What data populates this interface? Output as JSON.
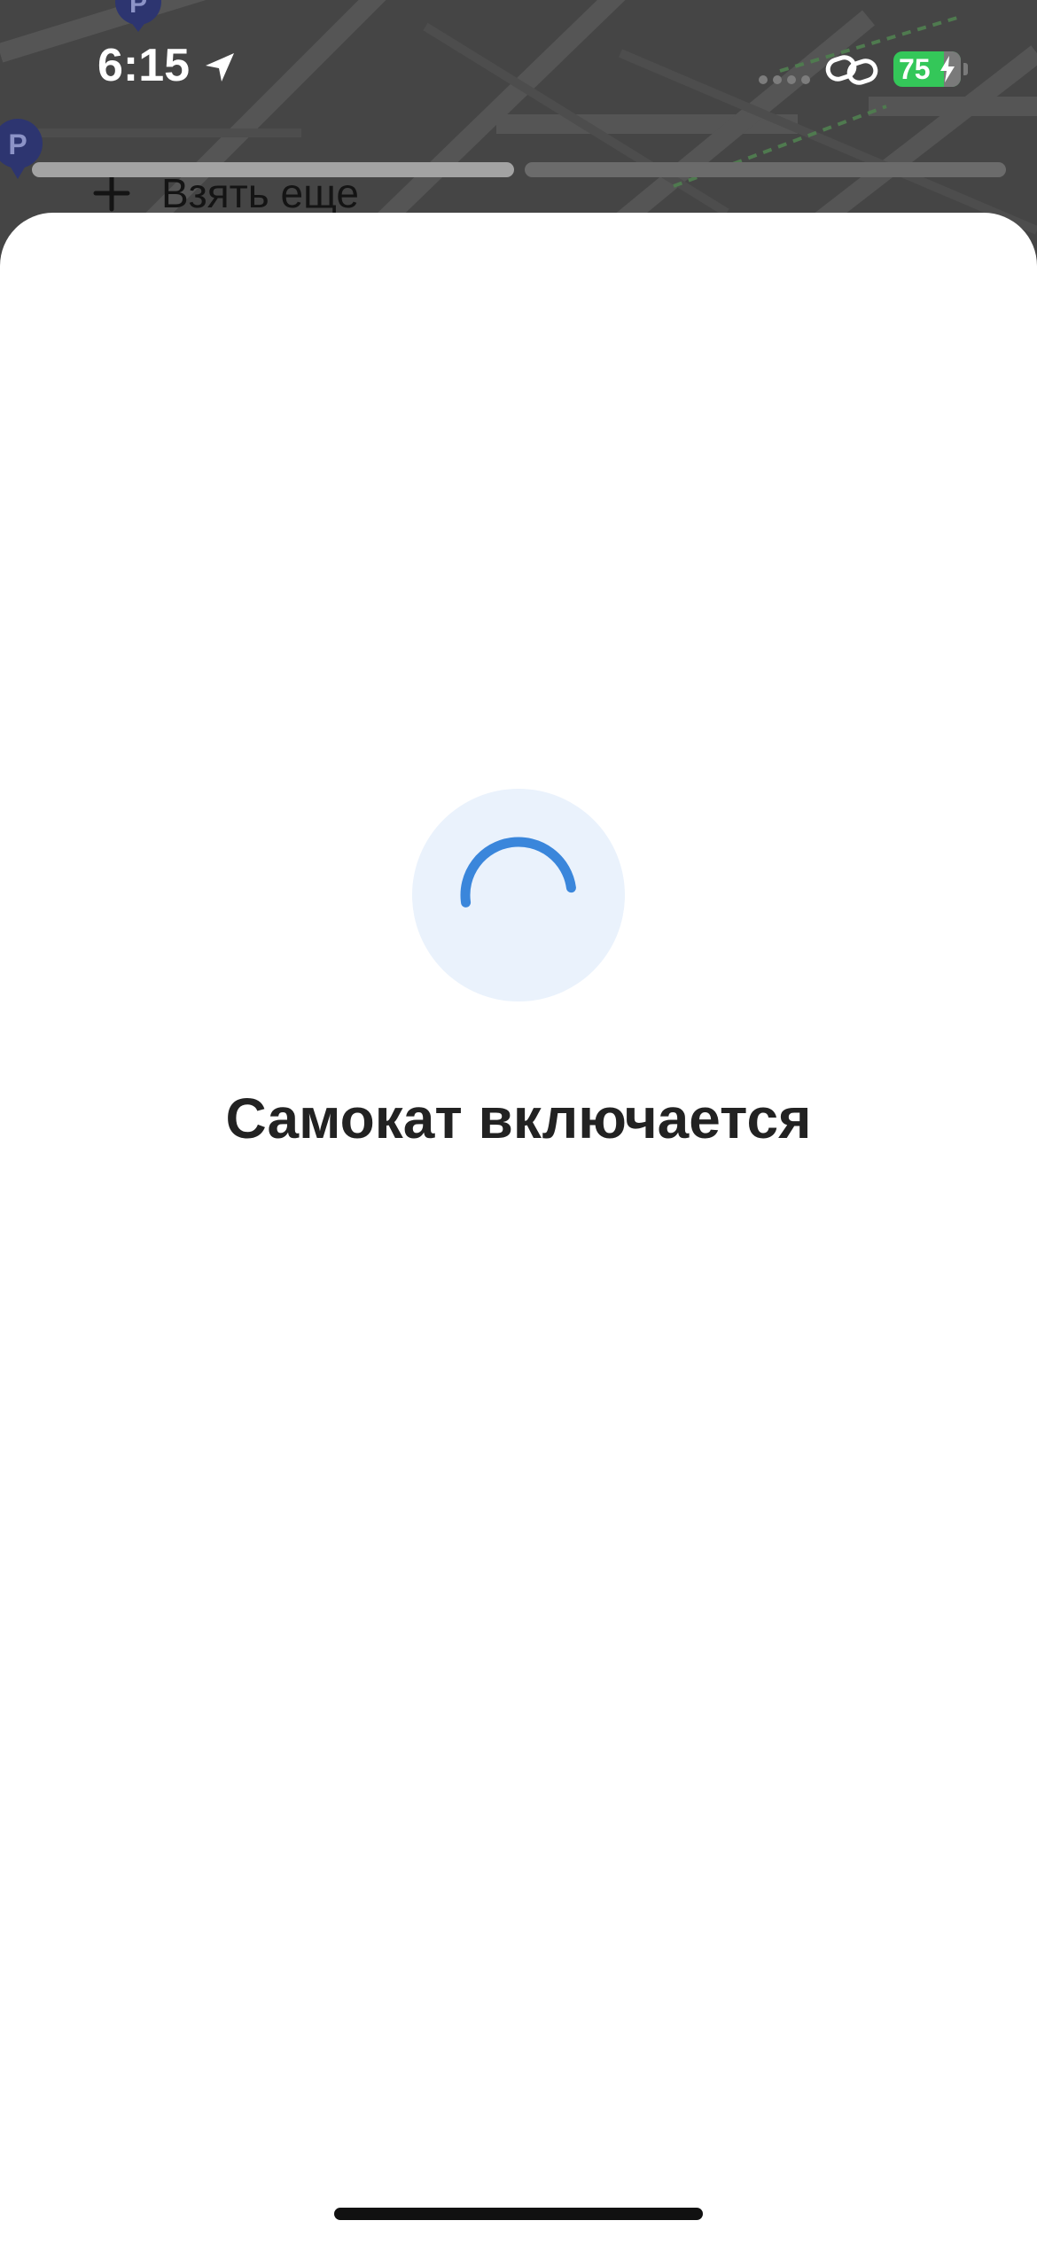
{
  "status_bar": {
    "time": "6:15",
    "battery_percent": "75",
    "battery_level": 0.75,
    "battery_color": "#34c759"
  },
  "stories_progress": {
    "segments": 2,
    "active_segment": 1
  },
  "background_panel": {
    "take_more_label": "Взять еще"
  },
  "sheet": {
    "status_text": "Самокат включается",
    "spinner_color": "#3a86db",
    "spinner_bg_color": "#eaf2fc"
  },
  "icons": {
    "location": "location-arrow-icon",
    "link": "link-icon",
    "plus": "plus-icon",
    "parking": "parking-pin-icon"
  }
}
